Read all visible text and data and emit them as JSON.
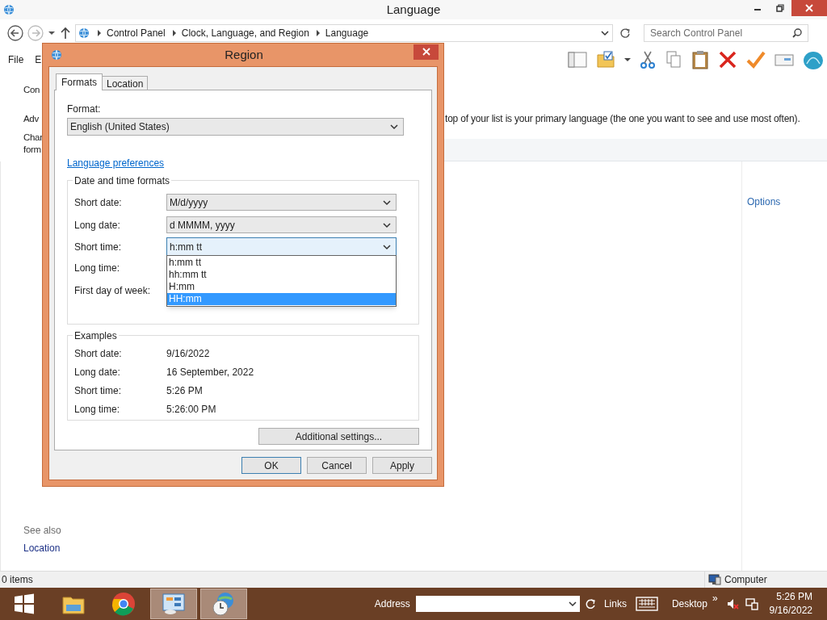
{
  "window": {
    "title": "Language"
  },
  "address_bar": {
    "breadcrumbs": [
      "Control Panel",
      "Clock, Language, and Region",
      "Language"
    ],
    "search_placeholder": "Search Control Panel"
  },
  "menu": [
    "File",
    "E"
  ],
  "left_pane": {
    "items": [
      "Con",
      "Adv",
      "Char",
      "form"
    ],
    "see_also": "See also",
    "links": [
      "Location"
    ]
  },
  "main": {
    "description": "top of your list is your primary language (the one you want to see and use most often).",
    "options_link": "Options"
  },
  "status_bar": {
    "items": "0 items",
    "zone": "Computer"
  },
  "dialog": {
    "title": "Region",
    "tabs": [
      {
        "label": "Formats",
        "selected": true
      },
      {
        "label": "Location",
        "selected": false
      }
    ],
    "format": {
      "label": "Format:",
      "value": "English (United States)"
    },
    "link": "Language preferences",
    "formats_group": {
      "title": "Date and time formats",
      "rows": [
        {
          "label": "Short date:",
          "value": "M/d/yyyy",
          "focused": false
        },
        {
          "label": "Long date:",
          "value": "d MMMM, yyyy",
          "focused": false
        },
        {
          "label": "Short time:",
          "value": "h:mm tt",
          "focused": true
        },
        {
          "label": "Long time:"
        },
        {
          "label": "First day of week:"
        }
      ]
    },
    "dropdown": {
      "options": [
        {
          "label": "h:mm tt",
          "selected": false
        },
        {
          "label": "hh:mm tt",
          "selected": false
        },
        {
          "label": "H:mm",
          "selected": false
        },
        {
          "label": "HH:mm",
          "selected": true
        }
      ]
    },
    "examples": {
      "title": "Examples",
      "rows": [
        {
          "label": "Short date:",
          "value": "9/16/2022"
        },
        {
          "label": "Long date:",
          "value": "16 September, 2022"
        },
        {
          "label": "Short time:",
          "value": "5:26 PM"
        },
        {
          "label": "Long time:",
          "value": "5:26:00 PM"
        }
      ]
    },
    "additional_button": "Additional settings...",
    "buttons": [
      {
        "label": "OK",
        "default": true
      },
      {
        "label": "Cancel",
        "default": false
      },
      {
        "label": "Apply",
        "default": false
      }
    ]
  },
  "taskbar": {
    "apps": [
      {
        "kind": "explorer",
        "selected": false
      },
      {
        "kind": "chrome",
        "selected": false
      },
      {
        "kind": "control-panel",
        "selected": true
      },
      {
        "kind": "clock-globe",
        "selected": true
      }
    ],
    "address_label": "Address",
    "links": "Links",
    "desktop": "Desktop",
    "chevron": "»",
    "time": "5:26 PM",
    "date": "9/16/2022"
  }
}
